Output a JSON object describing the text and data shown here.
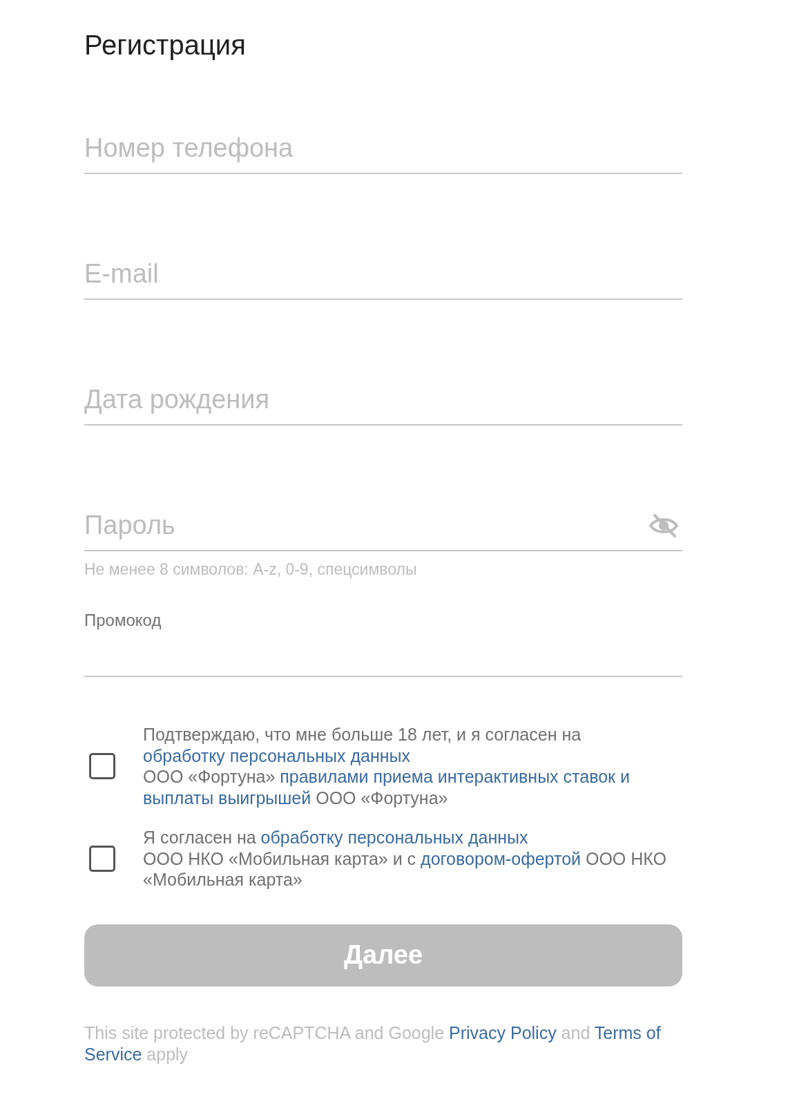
{
  "title": "Регистрация",
  "fields": [
    {
      "kind": "text",
      "placeholder": "Номер телефона"
    },
    {
      "kind": "text",
      "placeholder": "E-mail"
    },
    {
      "kind": "text",
      "placeholder": "Дата рождения"
    },
    {
      "kind": "password",
      "placeholder": "Пароль",
      "hint": "Не менее 8 символов: A-z, 0-9, спецсимволы"
    },
    {
      "kind": "labeled",
      "label": "Промокод"
    }
  ],
  "consents": [
    {
      "checked": false,
      "lines": [
        [
          {
            "kind": "text",
            "text": "Подтверждаю, что мне больше 18 лет, и я согласен на"
          }
        ],
        [
          {
            "kind": "link",
            "text": "обработку персональных данных"
          }
        ],
        [
          {
            "kind": "text",
            "text": "ООО «Фортуна»"
          },
          {
            "kind": "link",
            "text": "правилами приема интерактивных ставок и"
          }
        ],
        [
          {
            "kind": "link",
            "text": "выплаты выигрышей"
          },
          {
            "kind": "text",
            "text": "ООО «Фортуна»"
          }
        ]
      ]
    },
    {
      "checked": false,
      "lines": [
        [
          {
            "kind": "text",
            "text": "Я согласен на"
          },
          {
            "kind": "link",
            "text": "обработку персональных данных"
          }
        ],
        [
          {
            "kind": "text",
            "text": "ООО НКО «Мобильная карта» и с"
          },
          {
            "kind": "link",
            "text": "договором-офертой"
          },
          {
            "kind": "text",
            "text": "ООО НКО"
          }
        ],
        [
          {
            "kind": "text",
            "text": "«Мобильная карта»"
          }
        ]
      ]
    }
  ],
  "submit": {
    "label": "Далее",
    "disabled": true
  },
  "footer": {
    "lines": [
      [
        {
          "kind": "text",
          "text": "This site protected by reCAPTCHA and Google"
        },
        {
          "kind": "link",
          "text": "Privacy Policy"
        },
        {
          "kind": "text",
          "text": "and"
        },
        {
          "kind": "link",
          "text": "Terms of"
        }
      ],
      [
        {
          "kind": "link",
          "text": "Service"
        },
        {
          "kind": "text",
          "text": "apply"
        }
      ]
    ]
  }
}
